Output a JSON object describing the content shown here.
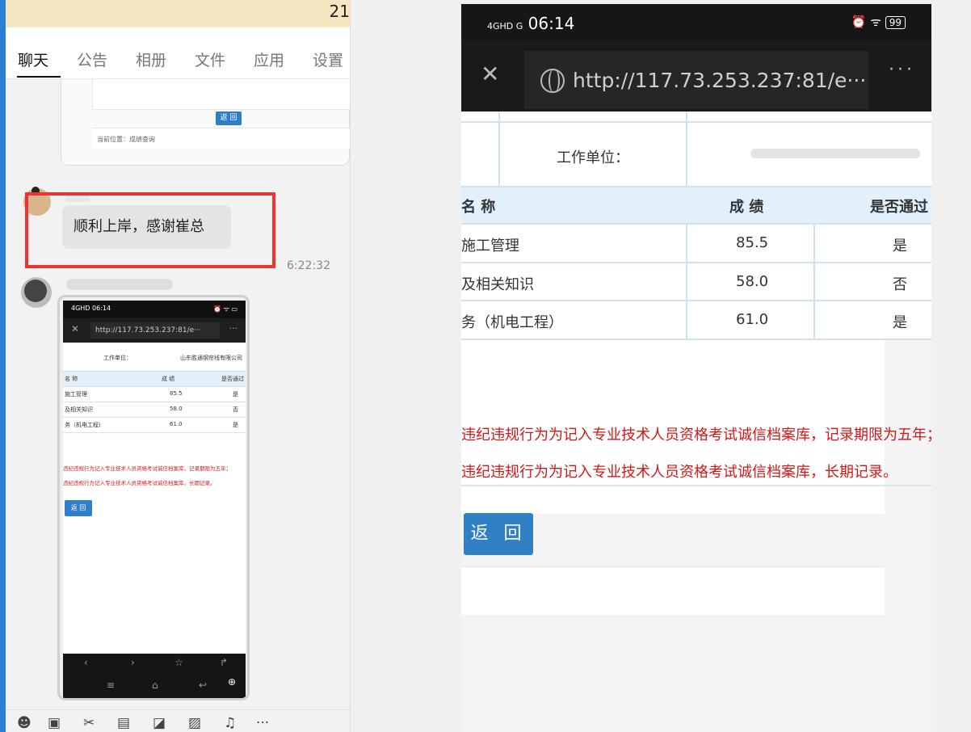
{
  "chat": {
    "top_number": "21",
    "tabs": [
      "聊天",
      "公告",
      "相册",
      "文件",
      "应用",
      "设置"
    ],
    "old_card": {
      "button": "返 回",
      "breadcrumb": "当前位置：成绩查询"
    },
    "message1": {
      "text": "顺利上岸，感谢崔总",
      "time": "6:22:32"
    }
  },
  "thumbnail": {
    "status_time": "06:14",
    "status_left": "4GHD",
    "url": "http://117.73.253.237:81/e···",
    "work_unit_label": "工作单位：",
    "work_unit_value": "山东胜通钢帘线有限公司",
    "headers": {
      "name": "名  称",
      "score": "成  绩",
      "pass": "是否通过"
    },
    "rows": [
      {
        "name": "施工管理",
        "score": "85.5",
        "pass": "是"
      },
      {
        "name": "及相关知识",
        "score": "58.0",
        "pass": "否"
      },
      {
        "name": "务（机电工程）",
        "score": "61.0",
        "pass": "是"
      }
    ],
    "notice1": "违纪违规行为记入专业技术人员资格考试诚信档案库，记录期限为五年；",
    "notice2": "违纪违规行为记入专业技术人员资格考试诚信档案库，长期记录。",
    "button": "返 回"
  },
  "phone": {
    "status_left": "4GHD G",
    "status_time": "06:14",
    "battery": "99",
    "url": "http://117.73.253.237:81/e···",
    "work_unit_label": "工作单位：",
    "headers": {
      "name": "名  称",
      "score": "成  绩",
      "pass": "是否通过"
    },
    "rows": [
      {
        "name": "施工管理",
        "score": "85.5",
        "pass": "是"
      },
      {
        "name": "及相关知识",
        "score": "58.0",
        "pass": "否"
      },
      {
        "name": "务（机电工程）",
        "score": "61.0",
        "pass": "是"
      }
    ],
    "notice1": "违纪违规行为为记入专业技术人员资格考试诚信档案库，记录期限为五年；",
    "notice2": "违纪违规行为为记入专业技术人员资格考试诚信档案库，长期记录。",
    "button": "返 回"
  },
  "colors": {
    "accent": "#2f80c5",
    "highlight": "#ee3333",
    "notice": "#d51616"
  },
  "toolbar_icons": [
    "emoji-icon",
    "gif-icon",
    "scissors-icon",
    "folder-icon",
    "image-edit-icon",
    "picture-icon",
    "bell-icon",
    "more-icon"
  ]
}
